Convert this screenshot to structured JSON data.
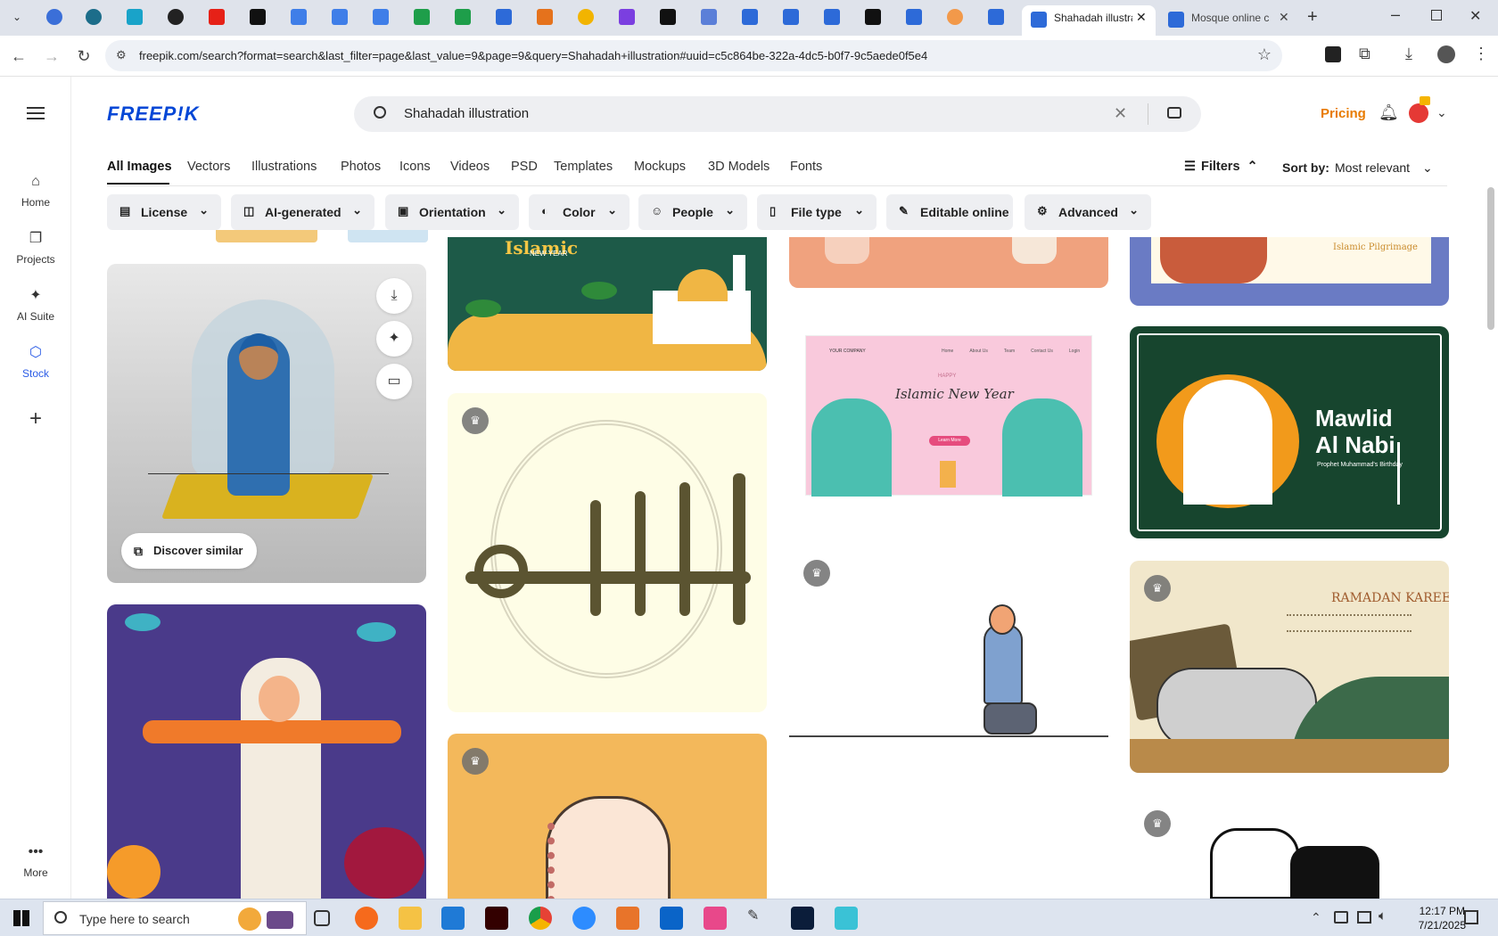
{
  "browser": {
    "tabs": [
      {
        "title": "Shahadah illustra",
        "active": true
      },
      {
        "title": "Mosque online c",
        "active": false
      }
    ],
    "url": "freepik.com/search?format=search&last_filter=page&last_value=9&page=9&query=Shahadah+illustration#uuid=c5c864be-322a-4dc5-b0f7-9c5aede0f5e4"
  },
  "sidebar": {
    "items": [
      {
        "label": "Home",
        "icon": "home-icon"
      },
      {
        "label": "Projects",
        "icon": "projects-icon"
      },
      {
        "label": "AI Suite",
        "icon": "sparkle-icon"
      },
      {
        "label": "Stock",
        "icon": "stock-icon"
      },
      {
        "label": "More",
        "icon": "more-icon"
      }
    ]
  },
  "header": {
    "logo": "FREEP!K",
    "search_value": "Shahadah illustration",
    "pricing": "Pricing"
  },
  "categories": [
    "All Images",
    "Vectors",
    "Illustrations",
    "Photos",
    "Icons",
    "Videos",
    "PSD",
    "Templates",
    "Mockups",
    "3D Models",
    "Fonts"
  ],
  "toolbar": {
    "filters": "Filters",
    "sort_label": "Sort by:",
    "sort_value": "Most relevant"
  },
  "chips": [
    "License",
    "AI-generated",
    "Orientation",
    "Color",
    "People",
    "File type",
    "Editable online",
    "Advanced"
  ],
  "cards": {
    "discover_similar": "Discover similar",
    "islamic_new_year_banner": "Islamic New Year",
    "islamic_new_year_top": "Islamic",
    "islamic_new_year_sub": "NEW YEAR",
    "happy": "HAPPY",
    "learn_more": "Learn More",
    "your_company": "YOUR COMPANY",
    "nav_links": [
      "Home",
      "About Us",
      "Team",
      "Contact Us",
      "Login"
    ],
    "islamic_pilgrimage": "Islamic Pilgrimage",
    "mawlid_line1": "Mawlid",
    "mawlid_line2": "Al Nabi",
    "mawlid_sub": "Prophet Muhammad's Birthday",
    "ramadan": "RAMADAN KAREEM"
  },
  "taskbar": {
    "search_placeholder": "Type here to search",
    "time": "12:17 PM",
    "date": "7/21/2025"
  }
}
